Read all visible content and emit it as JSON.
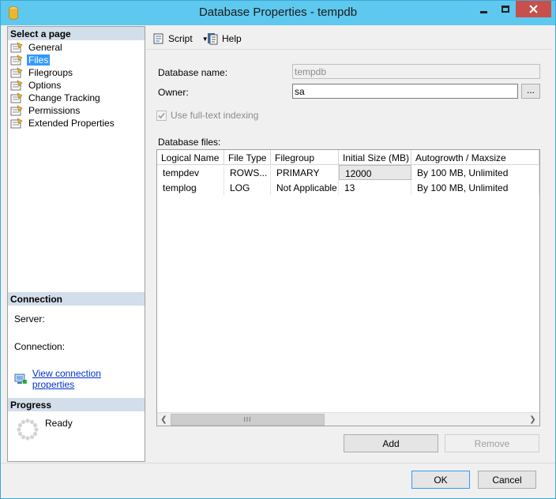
{
  "window": {
    "title": "Database Properties - tempdb"
  },
  "sidebar": {
    "select_page_header": "Select a page",
    "items": [
      {
        "label": "General"
      },
      {
        "label": "Files"
      },
      {
        "label": "Filegroups"
      },
      {
        "label": "Options"
      },
      {
        "label": "Change Tracking"
      },
      {
        "label": "Permissions"
      },
      {
        "label": "Extended Properties"
      }
    ],
    "selected_index": 1,
    "connection_header": "Connection",
    "server_label": "Server:",
    "connection_label": "Connection:",
    "view_connection_link": "View connection properties",
    "progress_header": "Progress",
    "progress_status": "Ready"
  },
  "toolbar": {
    "script_label": "Script",
    "help_label": "Help"
  },
  "form": {
    "db_name_label": "Database name:",
    "db_name_value": "tempdb",
    "owner_label": "Owner:",
    "owner_value": "sa",
    "browse_label": "...",
    "fulltext_label": "Use full-text indexing",
    "fulltext_checked": true,
    "db_files_label": "Database files:"
  },
  "files_table": {
    "columns": [
      "Logical Name",
      "File Type",
      "Filegroup",
      "Initial Size (MB)",
      "Autogrowth / Maxsize"
    ],
    "rows": [
      [
        "tempdev",
        "ROWS...",
        "PRIMARY",
        "12000",
        "By 100 MB, Unlimited"
      ],
      [
        "templog",
        "LOG",
        "Not Applicable",
        "13",
        "By 100 MB, Unlimited"
      ]
    ],
    "scroll_thumb": "III"
  },
  "buttons": {
    "add": "Add",
    "remove": "Remove",
    "ok": "OK",
    "cancel": "Cancel"
  },
  "colors": {
    "titlebar": "#5ec8ee",
    "selection": "#3399ff",
    "section_header": "#d3deeb",
    "close_button": "#c7504c"
  }
}
